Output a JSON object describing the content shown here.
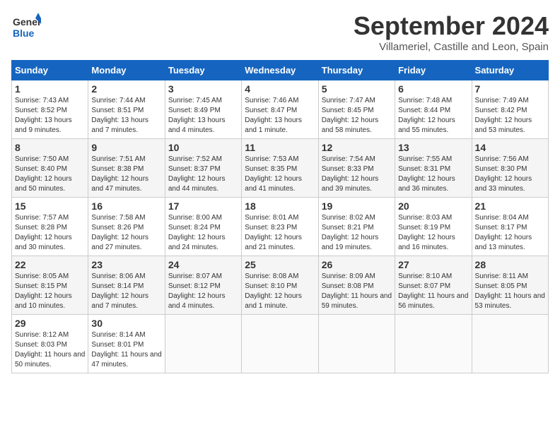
{
  "logo": {
    "line1": "General",
    "line2": "Blue"
  },
  "title": "September 2024",
  "location": "Villameriel, Castille and Leon, Spain",
  "days_header": [
    "Sunday",
    "Monday",
    "Tuesday",
    "Wednesday",
    "Thursday",
    "Friday",
    "Saturday"
  ],
  "weeks": [
    [
      {
        "day": "1",
        "sunrise": "7:43 AM",
        "sunset": "8:52 PM",
        "daylight": "13 hours and 9 minutes."
      },
      {
        "day": "2",
        "sunrise": "7:44 AM",
        "sunset": "8:51 PM",
        "daylight": "13 hours and 7 minutes."
      },
      {
        "day": "3",
        "sunrise": "7:45 AM",
        "sunset": "8:49 PM",
        "daylight": "13 hours and 4 minutes."
      },
      {
        "day": "4",
        "sunrise": "7:46 AM",
        "sunset": "8:47 PM",
        "daylight": "13 hours and 1 minute."
      },
      {
        "day": "5",
        "sunrise": "7:47 AM",
        "sunset": "8:45 PM",
        "daylight": "12 hours and 58 minutes."
      },
      {
        "day": "6",
        "sunrise": "7:48 AM",
        "sunset": "8:44 PM",
        "daylight": "12 hours and 55 minutes."
      },
      {
        "day": "7",
        "sunrise": "7:49 AM",
        "sunset": "8:42 PM",
        "daylight": "12 hours and 53 minutes."
      }
    ],
    [
      {
        "day": "8",
        "sunrise": "7:50 AM",
        "sunset": "8:40 PM",
        "daylight": "12 hours and 50 minutes."
      },
      {
        "day": "9",
        "sunrise": "7:51 AM",
        "sunset": "8:38 PM",
        "daylight": "12 hours and 47 minutes."
      },
      {
        "day": "10",
        "sunrise": "7:52 AM",
        "sunset": "8:37 PM",
        "daylight": "12 hours and 44 minutes."
      },
      {
        "day": "11",
        "sunrise": "7:53 AM",
        "sunset": "8:35 PM",
        "daylight": "12 hours and 41 minutes."
      },
      {
        "day": "12",
        "sunrise": "7:54 AM",
        "sunset": "8:33 PM",
        "daylight": "12 hours and 39 minutes."
      },
      {
        "day": "13",
        "sunrise": "7:55 AM",
        "sunset": "8:31 PM",
        "daylight": "12 hours and 36 minutes."
      },
      {
        "day": "14",
        "sunrise": "7:56 AM",
        "sunset": "8:30 PM",
        "daylight": "12 hours and 33 minutes."
      }
    ],
    [
      {
        "day": "15",
        "sunrise": "7:57 AM",
        "sunset": "8:28 PM",
        "daylight": "12 hours and 30 minutes."
      },
      {
        "day": "16",
        "sunrise": "7:58 AM",
        "sunset": "8:26 PM",
        "daylight": "12 hours and 27 minutes."
      },
      {
        "day": "17",
        "sunrise": "8:00 AM",
        "sunset": "8:24 PM",
        "daylight": "12 hours and 24 minutes."
      },
      {
        "day": "18",
        "sunrise": "8:01 AM",
        "sunset": "8:23 PM",
        "daylight": "12 hours and 21 minutes."
      },
      {
        "day": "19",
        "sunrise": "8:02 AM",
        "sunset": "8:21 PM",
        "daylight": "12 hours and 19 minutes."
      },
      {
        "day": "20",
        "sunrise": "8:03 AM",
        "sunset": "8:19 PM",
        "daylight": "12 hours and 16 minutes."
      },
      {
        "day": "21",
        "sunrise": "8:04 AM",
        "sunset": "8:17 PM",
        "daylight": "12 hours and 13 minutes."
      }
    ],
    [
      {
        "day": "22",
        "sunrise": "8:05 AM",
        "sunset": "8:15 PM",
        "daylight": "12 hours and 10 minutes."
      },
      {
        "day": "23",
        "sunrise": "8:06 AM",
        "sunset": "8:14 PM",
        "daylight": "12 hours and 7 minutes."
      },
      {
        "day": "24",
        "sunrise": "8:07 AM",
        "sunset": "8:12 PM",
        "daylight": "12 hours and 4 minutes."
      },
      {
        "day": "25",
        "sunrise": "8:08 AM",
        "sunset": "8:10 PM",
        "daylight": "12 hours and 1 minute."
      },
      {
        "day": "26",
        "sunrise": "8:09 AM",
        "sunset": "8:08 PM",
        "daylight": "11 hours and 59 minutes."
      },
      {
        "day": "27",
        "sunrise": "8:10 AM",
        "sunset": "8:07 PM",
        "daylight": "11 hours and 56 minutes."
      },
      {
        "day": "28",
        "sunrise": "8:11 AM",
        "sunset": "8:05 PM",
        "daylight": "11 hours and 53 minutes."
      }
    ],
    [
      {
        "day": "29",
        "sunrise": "8:12 AM",
        "sunset": "8:03 PM",
        "daylight": "11 hours and 50 minutes."
      },
      {
        "day": "30",
        "sunrise": "8:14 AM",
        "sunset": "8:01 PM",
        "daylight": "11 hours and 47 minutes."
      },
      null,
      null,
      null,
      null,
      null
    ]
  ]
}
